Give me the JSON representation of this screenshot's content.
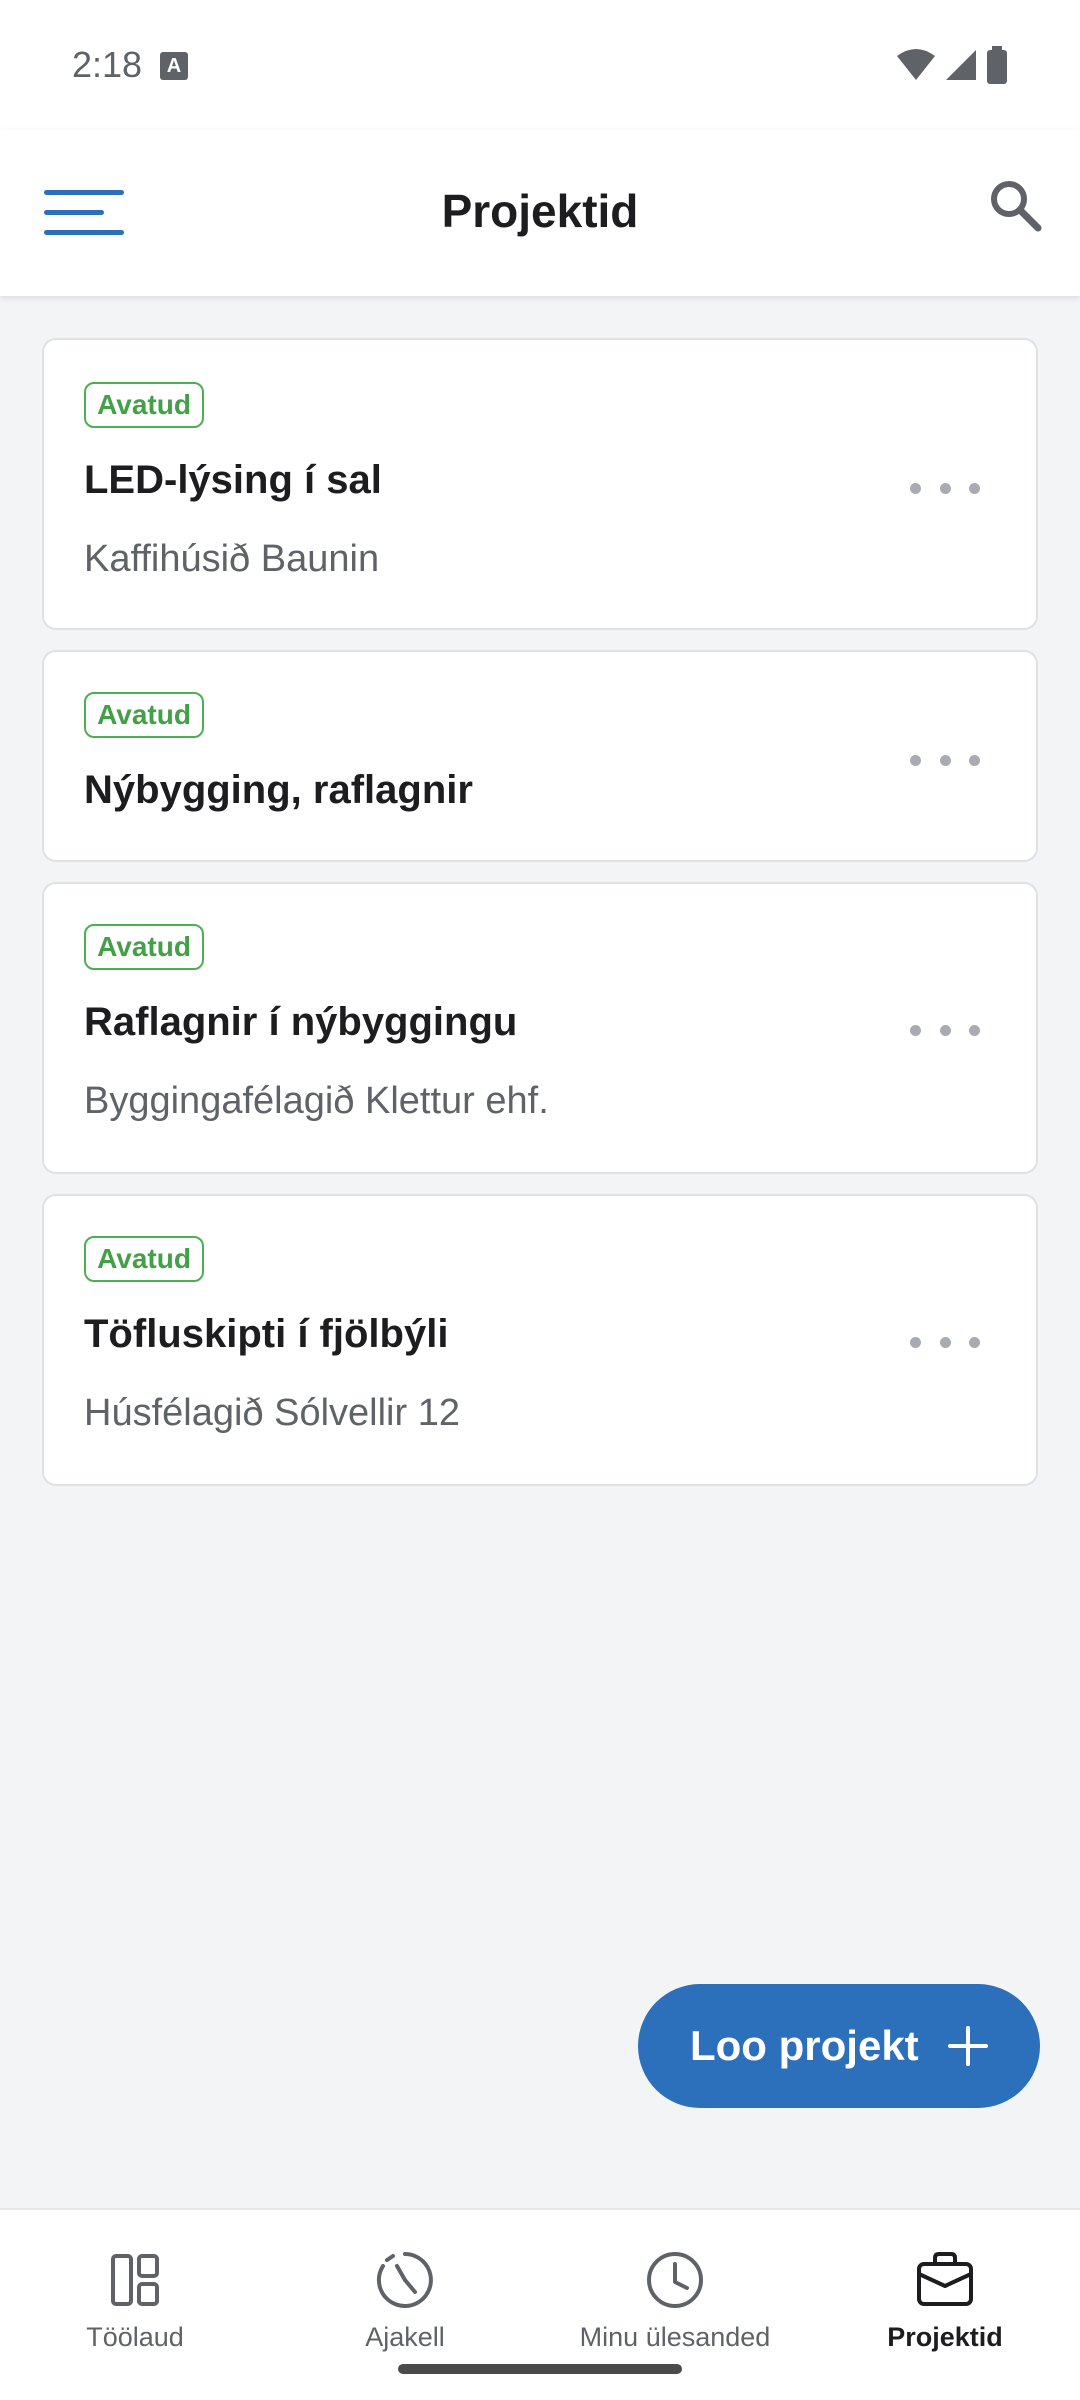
{
  "status_bar": {
    "time": "2:18",
    "notification_icon": "A"
  },
  "app_bar": {
    "title": "Projektid",
    "menu_icon": "hamburger-icon",
    "search_icon": "search-icon"
  },
  "projects": [
    {
      "status": "Avatud",
      "title": "LED-lýsing í sal",
      "client": "Kaffihúsið Baunin"
    },
    {
      "status": "Avatud",
      "title": "Nýbygging, raflagnir",
      "client": ""
    },
    {
      "status": "Avatud",
      "title": "Raflagnir í nýbyggingu",
      "client": "Byggingafélagið Klettur ehf."
    },
    {
      "status": "Avatud",
      "title": "Töfluskipti í fjölbýli",
      "client": "Húsfélagið Sólvellir 12"
    }
  ],
  "fab": {
    "label": "Loo projekt",
    "icon": "plus-icon"
  },
  "bottom_nav": [
    {
      "label": "Töölaud",
      "icon": "dashboard-icon",
      "active": false
    },
    {
      "label": "Ajakell",
      "icon": "timer-icon",
      "active": false
    },
    {
      "label": "Minu ülesanded",
      "icon": "clock-icon",
      "active": false
    },
    {
      "label": "Projektid",
      "icon": "briefcase-icon",
      "active": true
    }
  ],
  "colors": {
    "accent": "#2c6fbb",
    "status_green": "#43a047",
    "background": "#f3f4f6"
  }
}
